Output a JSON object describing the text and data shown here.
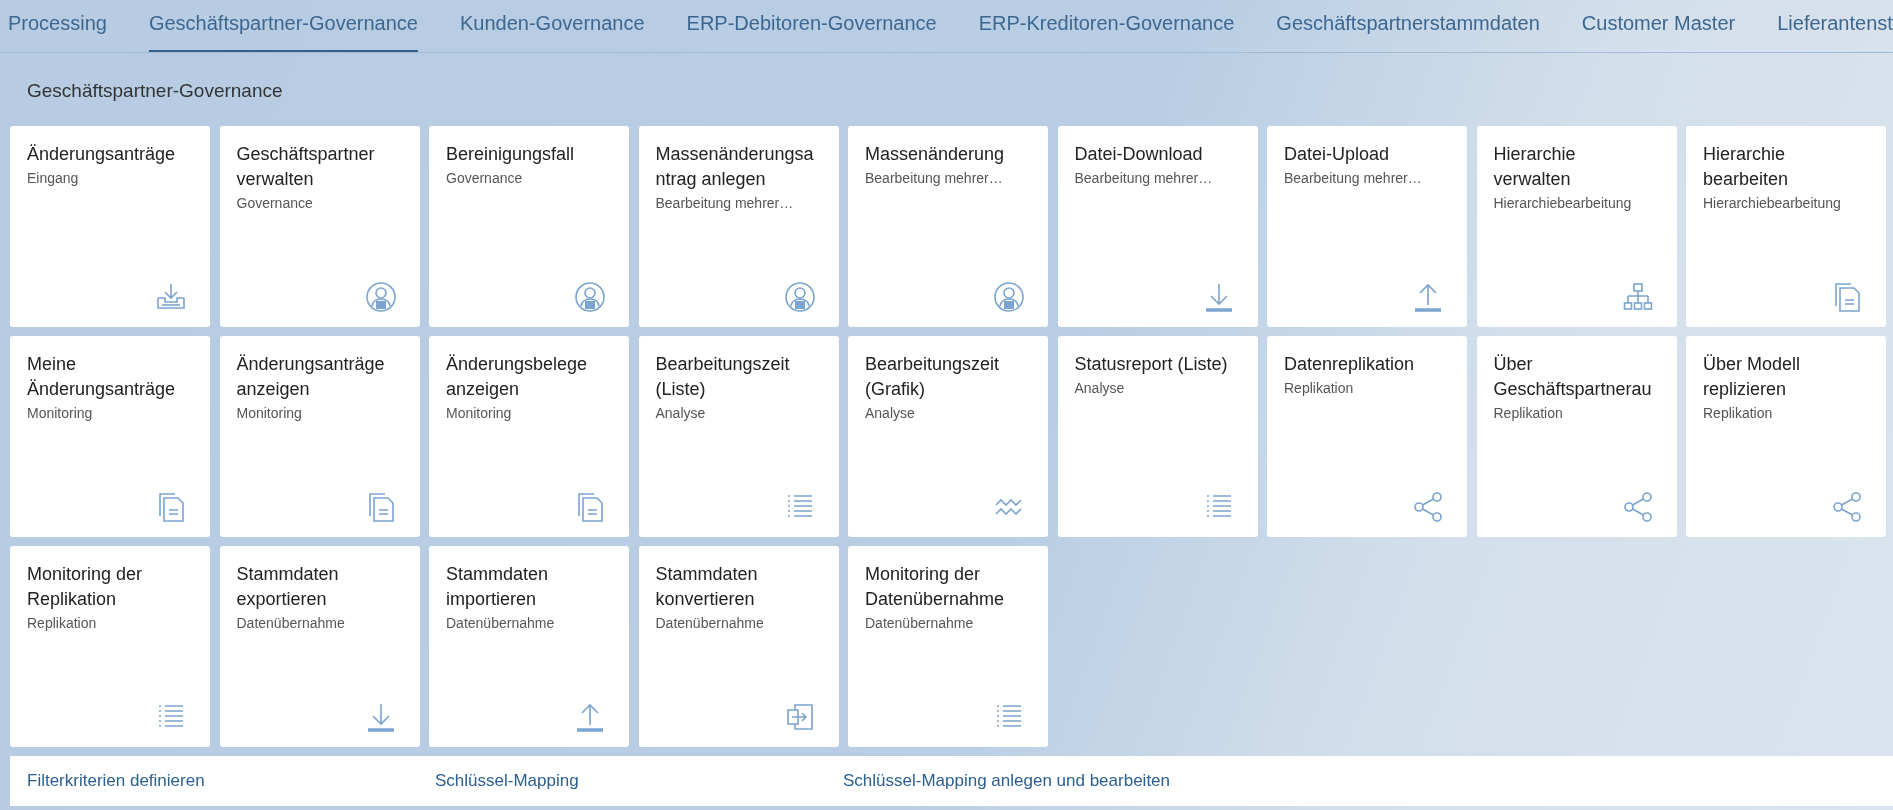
{
  "tabs": [
    {
      "label": "Processing",
      "selected": false
    },
    {
      "label": "Geschäftspartner-Governance",
      "selected": true
    },
    {
      "label": "Kunden-Governance",
      "selected": false
    },
    {
      "label": "ERP-Debitoren-Governance",
      "selected": false
    },
    {
      "label": "ERP-Kreditoren-Governance",
      "selected": false
    },
    {
      "label": "Geschäftspartnerstammdaten",
      "selected": false
    },
    {
      "label": "Customer Master",
      "selected": false
    },
    {
      "label": "Lieferantenst",
      "selected": false
    }
  ],
  "section": {
    "title": "Geschäftspartner-Governance"
  },
  "tiles": [
    {
      "title": "Änderungsanträge",
      "subtitle": "Eingang",
      "kind": "inbox"
    },
    {
      "title": "Geschäftspartner verwalten",
      "subtitle": "Governance",
      "kind": "person"
    },
    {
      "title": "Bereinigungsfall",
      "subtitle": "Governance",
      "kind": "person"
    },
    {
      "title": "Massenänderungsantrag anlegen",
      "subtitle": "Bearbeitung mehrer…",
      "kind": "person"
    },
    {
      "title": "Massenänderung",
      "subtitle": "Bearbeitung mehrer…",
      "kind": "person"
    },
    {
      "title": "Datei-Download",
      "subtitle": "Bearbeitung mehrer…",
      "kind": "download"
    },
    {
      "title": "Datei-Upload",
      "subtitle": "Bearbeitung mehrer…",
      "kind": "upload"
    },
    {
      "title": "Hierarchie verwalten",
      "subtitle": "Hierarchiebearbeitung",
      "kind": "hierarchy"
    },
    {
      "title": "Hierarchie bearbeiten",
      "subtitle": "Hierarchiebearbeitung",
      "kind": "documents"
    },
    {
      "title": "Meine Änderungsanträge",
      "subtitle": "Monitoring",
      "kind": "documents"
    },
    {
      "title": "Änderungsanträge anzeigen",
      "subtitle": "Monitoring",
      "kind": "documents"
    },
    {
      "title": "Änderungsbelege anzeigen",
      "subtitle": "Monitoring",
      "kind": "documents"
    },
    {
      "title": "Bearbeitungszeit (Liste)",
      "subtitle": "Analyse",
      "kind": "list"
    },
    {
      "title": "Bearbeitungszeit (Grafik)",
      "subtitle": "Analyse",
      "kind": "wave"
    },
    {
      "title": "Statusreport (Liste)",
      "subtitle": "Analyse",
      "kind": "list"
    },
    {
      "title": "Datenreplikation",
      "subtitle": "Replikation",
      "kind": "share"
    },
    {
      "title": "Über Geschäftspartnerau",
      "subtitle": "Replikation",
      "kind": "share"
    },
    {
      "title": "Über Modell replizieren",
      "subtitle": "Replikation",
      "kind": "share"
    },
    {
      "title": "Monitoring der Replikation",
      "subtitle": "Replikation",
      "kind": "list"
    },
    {
      "title": "Stammdaten exportieren",
      "subtitle": "Datenübernahme",
      "kind": "download"
    },
    {
      "title": "Stammdaten importieren",
      "subtitle": "Datenübernahme",
      "kind": "upload"
    },
    {
      "title": "Stammdaten konvertieren",
      "subtitle": "Datenübernahme",
      "kind": "transfer"
    },
    {
      "title": "Monitoring der Datenübernahme",
      "subtitle": "Datenübernahme",
      "kind": "list"
    }
  ],
  "links": [
    "Filterkriterien definieren",
    "Schlüssel-Mapping",
    "Schlüssel-Mapping anlegen und bearbeiten"
  ]
}
